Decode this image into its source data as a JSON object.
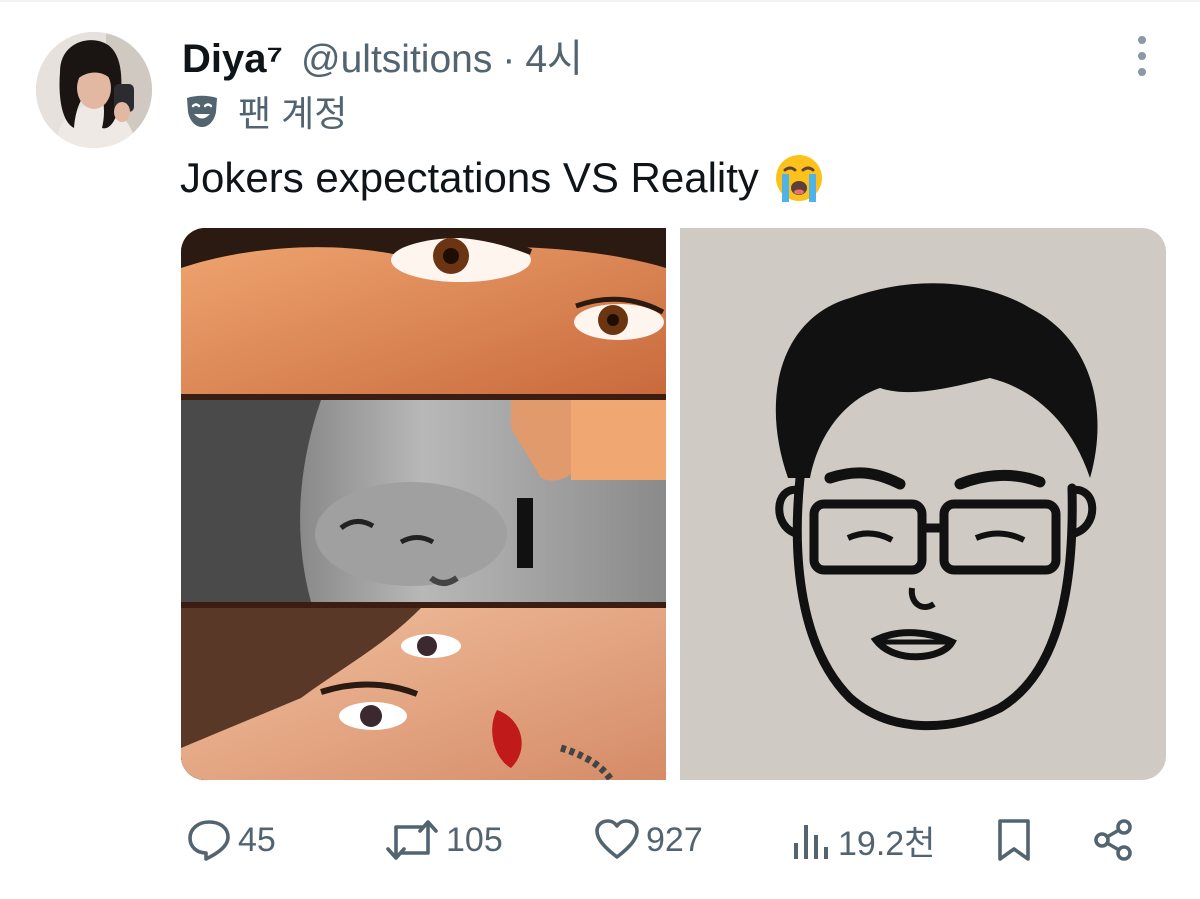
{
  "tweet": {
    "author": {
      "display_name": "Diya⁷",
      "handle": "@ultsitions",
      "separator": "·",
      "time": "4시",
      "account_label": "팬 계정"
    },
    "text": "Jokers expectations VS Reality",
    "emoji": "loudly-crying-face",
    "media": [
      {
        "name": "expectation-artwork",
        "description": "realistic three-panel painted portrait"
      },
      {
        "name": "reality-sketch",
        "description": "simple black marker caricature with glasses"
      }
    ],
    "actions": {
      "replies": "45",
      "retweets": "105",
      "likes": "927",
      "views": "19.2천"
    }
  },
  "icons": {
    "more": "more-dots-icon",
    "account": "theater-mask-icon",
    "reply": "reply-icon",
    "retweet": "retweet-icon",
    "like": "heart-icon",
    "views": "views-chart-icon",
    "bookmark": "bookmark-icon",
    "share": "share-icon"
  },
  "colors": {
    "text": "#0f1419",
    "muted": "#536471",
    "background": "#ffffff",
    "icon": "#536471"
  }
}
